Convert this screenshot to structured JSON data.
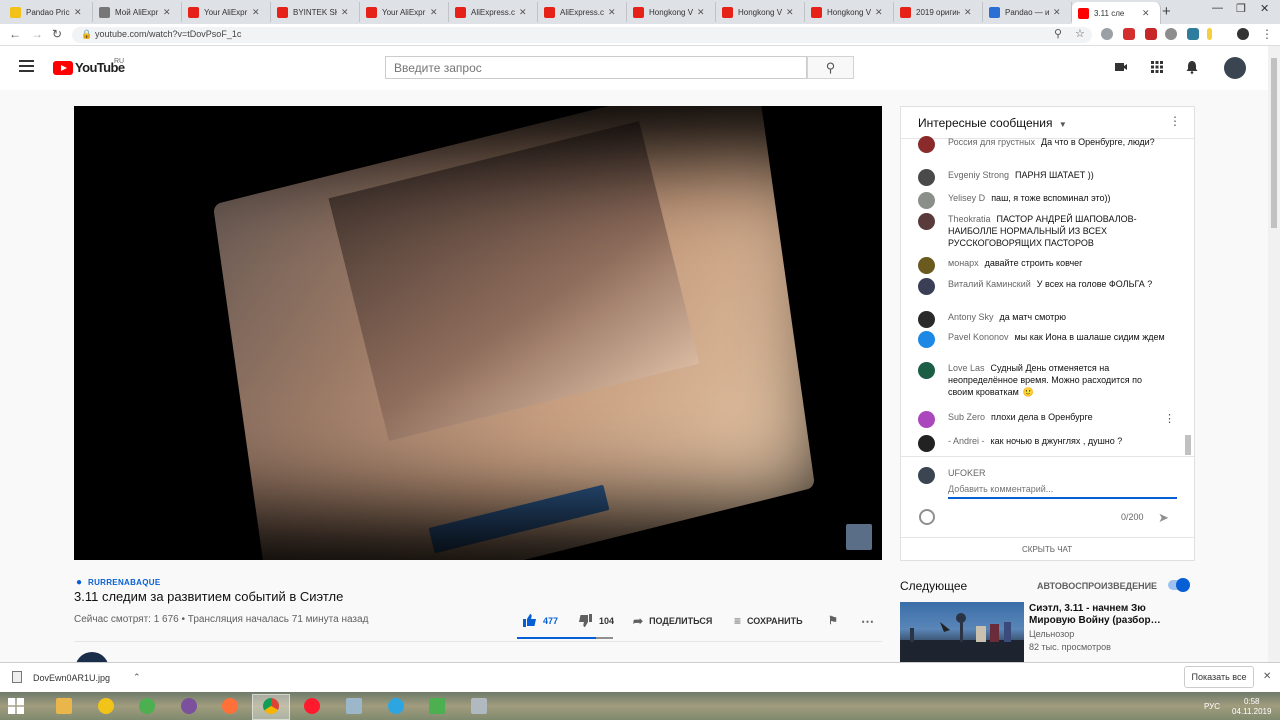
{
  "browser": {
    "tabs": [
      {
        "label": "Pandao Price",
        "color": "#f2c21a"
      },
      {
        "label": "Мой AliExpr",
        "color": "#777777"
      },
      {
        "label": "Your AliExpr",
        "color": "#e62117"
      },
      {
        "label": "BYINTEK SKY",
        "color": "#e62117"
      },
      {
        "label": "Your AliExpr",
        "color": "#e62117"
      },
      {
        "label": "AliExpress.co",
        "color": "#e62117"
      },
      {
        "label": "AliExpress.co",
        "color": "#e62117"
      },
      {
        "label": "Hongkong V",
        "color": "#e62117"
      },
      {
        "label": "Hongkong V",
        "color": "#e62117"
      },
      {
        "label": "Hongkong V",
        "color": "#e62117"
      },
      {
        "label": "2019 оригин",
        "color": "#e62117"
      },
      {
        "label": "Pandao — и",
        "color": "#2c6fd4"
      },
      {
        "label": "3.11 сле",
        "color": "#ff0000",
        "active": true
      }
    ],
    "new_tab": "+",
    "url": "youtube.com/watch?v=tDovPsoF_1c"
  },
  "header": {
    "logo_word": "YouTube",
    "logo_region": "RU",
    "search_placeholder": "Введите запрос"
  },
  "video": {
    "location": "RURRENABAQUE",
    "title": "3.11 следим за развитием событий в Сиэтле",
    "viewers": "Сейчас смотрят: 1 676 • Трансляция началась 71 минута назад",
    "likes": "477",
    "dislikes": "104",
    "share_label": "ПОДЕЛИТЬСЯ",
    "save_label": "СОХРАНИТЬ",
    "like_ratio": 0.82
  },
  "chat": {
    "header": "Интересные сообщения",
    "messages": [
      {
        "author": "Россия для грустных",
        "text": "Да что в Оренбурге, люди?",
        "color": "#8a2a2a"
      },
      {
        "author": "Evgeniy Strong",
        "text": "ПАРНЯ ШАТАЕТ ))",
        "color": "#4a4a4a"
      },
      {
        "author": "Yelisey D",
        "text": "паш, я тоже вспоминал это))",
        "color": "#8b8f8a"
      },
      {
        "author": "Theokratia",
        "text": "ПАСТОР АНДРЕЙ ШАПОВАЛОВ- НАИБОЛЛЕ НОРМАЛЬНЫЙ ИЗ ВСЕХ РУССКОГОВОРЯЩИХ ПАСТОРОВ",
        "color": "#5a3b3b"
      },
      {
        "author": "монарх",
        "text": "давайте строить ковчег",
        "color": "#6b5a1e"
      },
      {
        "author": "Виталий Каминский",
        "text": "У всех на голове ФОЛЬГА ?",
        "color": "#3b3f55"
      },
      {
        "author": "Antony Sky",
        "text": "да матч смотрю",
        "color": "#2a2a2a"
      },
      {
        "author": "Pavel Kononov",
        "text": "мы как Иона в шалаше сидим ждем",
        "color": "#1e88e5"
      },
      {
        "author": "Love Las",
        "text": "Судный День отменяется на неопределённое время. Можно расходится по своим кроваткам",
        "emoji": "🙂",
        "color": "#1b5e45"
      },
      {
        "author": "Sub Zero",
        "text": "плохи дела в Оренбурге",
        "color": "#ab47bc"
      },
      {
        "author": "- Andrei -",
        "text": "как ночью в джунглях , душно ?",
        "color": "#222222"
      }
    ],
    "me": "UFOKER",
    "input_placeholder": "Добавить комментарий...",
    "counter": "0/200",
    "hide_chat": "СКРЫТЬ ЧАТ"
  },
  "next": {
    "label": "Следующее",
    "autoplay_label": "АВТОВОСПРОИЗВЕДЕНИЕ",
    "autoplay_on": true,
    "item": {
      "title": "Сиэтл, 3.11 - начнем Зю Мировую Войну (разбор…",
      "channel": "Цельнозор",
      "views": "82 тыс. просмотров"
    }
  },
  "downloads": {
    "filename": "DovEwn0AR1U.jpg",
    "show_all": "Показать все"
  },
  "taskbar": {
    "lang": "РУС",
    "time": "0:58",
    "date": "04.11.2019"
  }
}
